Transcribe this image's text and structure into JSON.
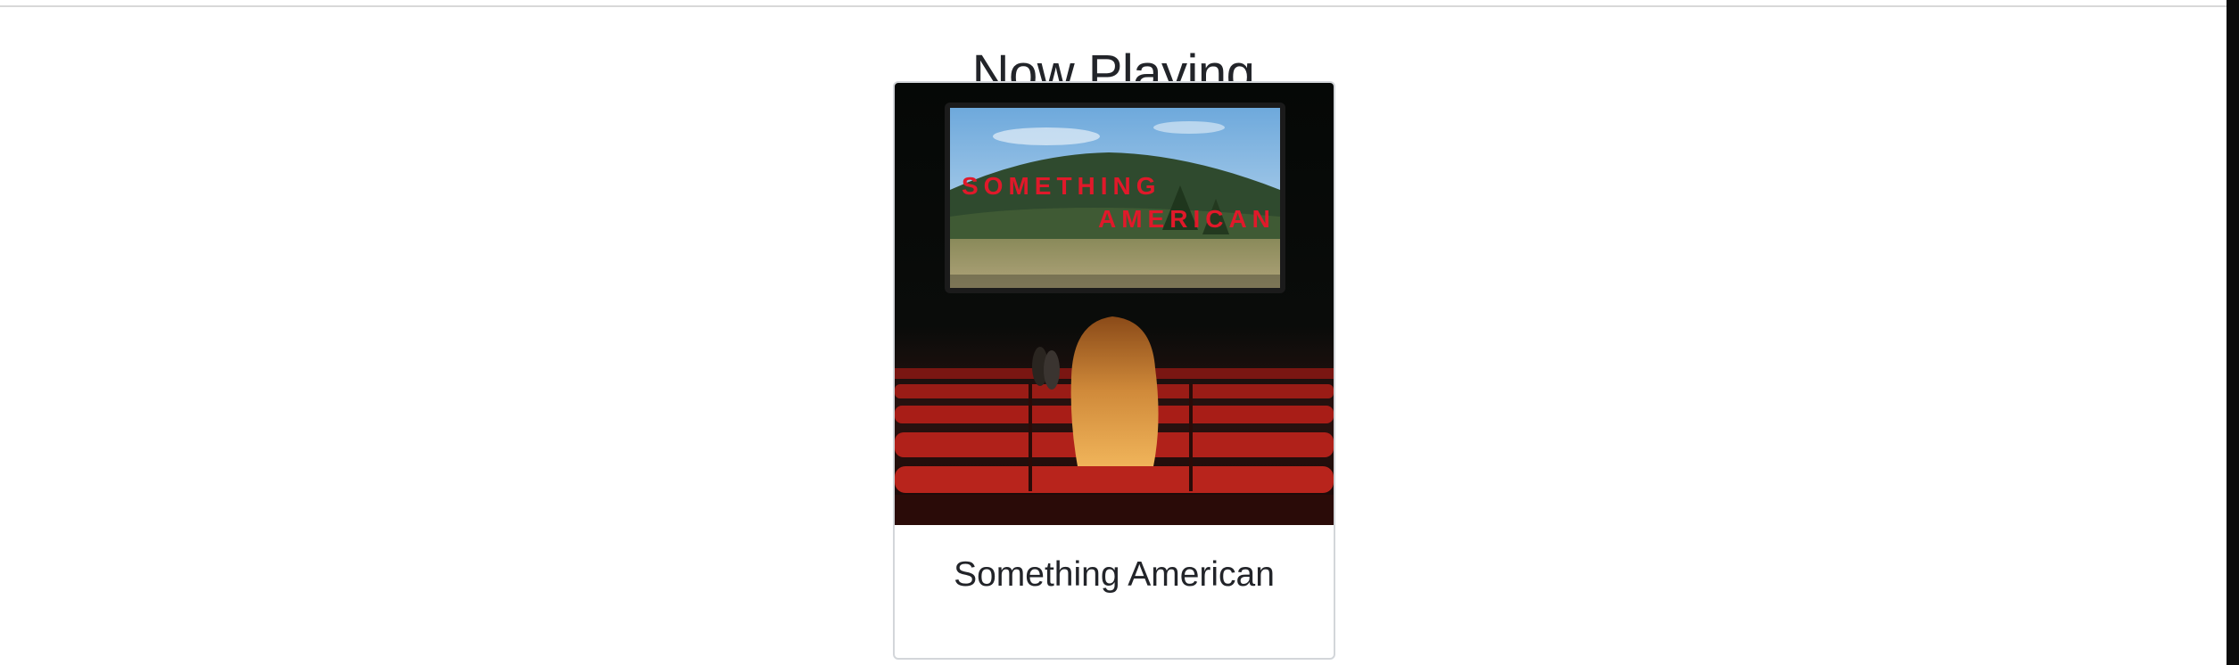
{
  "page": {
    "heading": "Now Playing"
  },
  "now_playing": {
    "title": "Something American",
    "cover_text": {
      "line1": "SOMETHING",
      "line2": "AMERICAN"
    }
  },
  "colors": {
    "background": "#ffffff",
    "text": "#222429",
    "card_border": "#d3d6da",
    "cover_title_red": "#e0192a",
    "seat_red": "#a81d17"
  }
}
